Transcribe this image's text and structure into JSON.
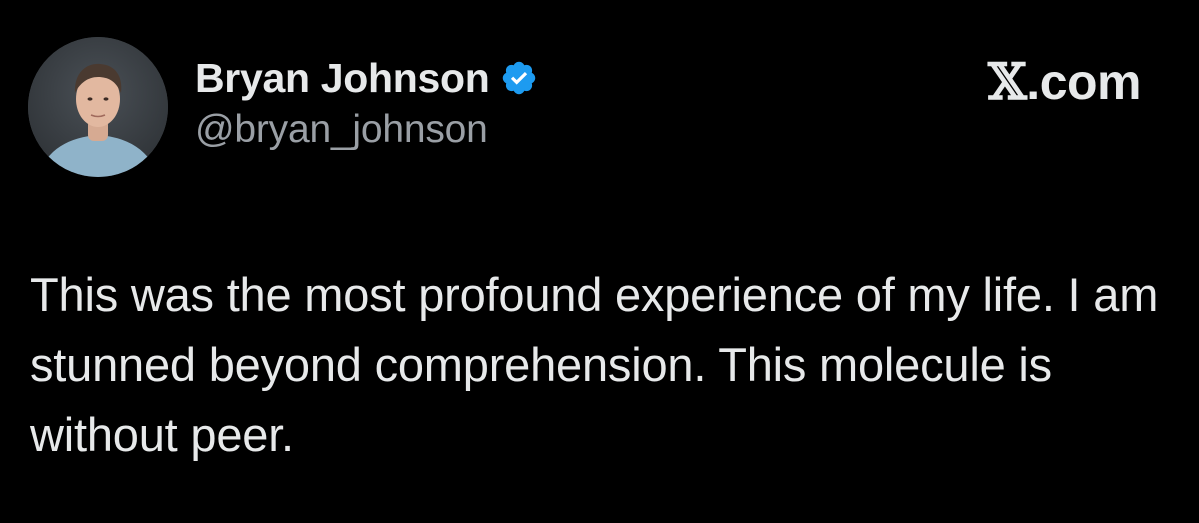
{
  "tweet": {
    "author": {
      "name": "Bryan Johnson",
      "handle": "@bryan_johnson",
      "verified": true,
      "verified_color": "#1d9bf0",
      "avatar_icon": "profile-photo"
    },
    "brand": {
      "mark": "𝕏",
      "suffix": ".com"
    },
    "text": "This was the most profound experience of my life. I am stunned beyond comprehension. This molecule is without peer."
  },
  "colors": {
    "background": "#000000",
    "primary_text": "#e7e9ea",
    "secondary_text": "#9a9fa5"
  }
}
